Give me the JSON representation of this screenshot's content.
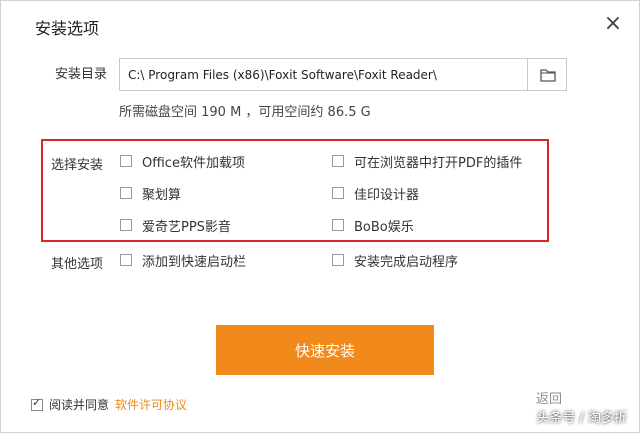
{
  "dialog": {
    "title": "安装选项",
    "close_glyph": "×"
  },
  "install_dir": {
    "label": "安装目录",
    "path": "C:\\ Program Files (x86)\\Foxit Software\\Foxit Reader\\",
    "disk_info": "所需磁盘空间 190 M ，可用空间约 86.5 G"
  },
  "select_install": {
    "label": "选择安装",
    "options": [
      {
        "label": "Office软件加载项",
        "checked": false
      },
      {
        "label": "可在浏览器中打开PDF的插件",
        "checked": false
      },
      {
        "label": "聚划算",
        "checked": false
      },
      {
        "label": "佳印设计器",
        "checked": false
      },
      {
        "label": "爱奇艺PPS影音",
        "checked": false
      },
      {
        "label": "BoBo娱乐",
        "checked": false
      }
    ]
  },
  "other_options": {
    "label": "其他选项",
    "options": [
      {
        "label": "添加到快速启动栏",
        "checked": false
      },
      {
        "label": "安装完成启动程序",
        "checked": false
      }
    ]
  },
  "install_button": {
    "label": "快速安装"
  },
  "agreement": {
    "text": "阅读并同意",
    "link": "软件许可协议",
    "checked": true
  },
  "watermark": {
    "partial": "返回",
    "text": "头条号 / 淘多折"
  },
  "colors": {
    "accent": "#f18a1a",
    "highlight_border": "#d9262b"
  }
}
